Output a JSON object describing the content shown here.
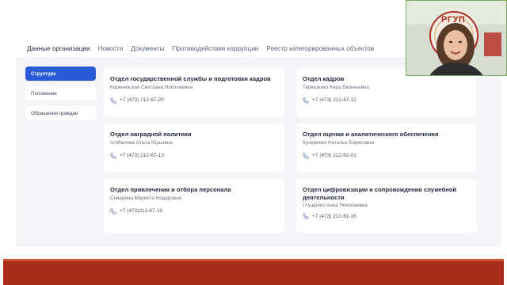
{
  "tabs": [
    {
      "label": "Данные организации",
      "active": true
    },
    {
      "label": "Новости",
      "active": false
    },
    {
      "label": "Документы",
      "active": false
    },
    {
      "label": "Противодействие коррупции",
      "active": false
    },
    {
      "label": "Реестр категорированных объектов",
      "active": false
    }
  ],
  "sidebar": {
    "items": [
      {
        "label": "Структура",
        "active": true
      },
      {
        "label": "Положение",
        "active": false
      },
      {
        "label": "Обращения граждан",
        "active": false
      }
    ]
  },
  "cards": [
    {
      "title": "Отдел государственной службы и подготовки кадров",
      "person": "Кореневская Светлана Николаевна",
      "phone": "+7 (473) 212-67-20"
    },
    {
      "title": "Отдел кадров",
      "person": "Терещенко Кира Евгеньевна",
      "phone": "+7 (473) 212-67-12"
    },
    {
      "title": "Отдел наградной политики",
      "person": "Агибалова Ольга Юрьевна",
      "phone": "+7 (473) 212-67-13"
    },
    {
      "title": "Отдел оценки и аналитического обеспечения",
      "person": "Кучеренко Наталья Борисовна",
      "phone": "+7 (473) 212-62-01"
    },
    {
      "title": "Отдел привлечения и отбора персонала",
      "person": "Северина Мариета Нодаровна",
      "phone": "+7 (473)212-67-19"
    },
    {
      "title": "Отдел цифровизации и сопровождения служебной деятельности",
      "person": "Глущенко Анна Николаевна",
      "phone": "+7 (473) 212-61-16"
    }
  ],
  "webcam": {
    "logo_text": "РГУП"
  },
  "colors": {
    "accent": "#2a5bd7",
    "footer_red": "#a72b18"
  }
}
